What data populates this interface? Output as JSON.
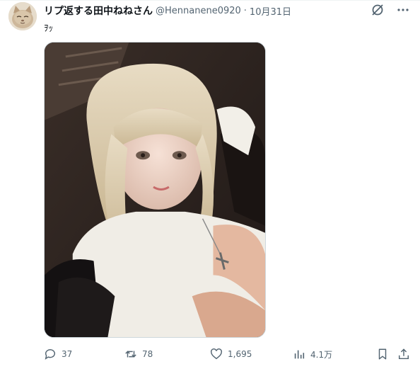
{
  "tweet": {
    "author": {
      "display_name": "リプ返する田中ねねさん",
      "handle": "@Hennanene0920",
      "avatar_icon": "cat-avatar"
    },
    "separator": "·",
    "date": "10月31日",
    "text": "ｦｯ",
    "media": {
      "kind": "photo"
    },
    "actions": {
      "reply_count": "37",
      "retweet_count": "78",
      "like_count": "1,695",
      "view_count": "4.1万"
    },
    "icons": {
      "grok": "grok-icon",
      "more": "more-icon",
      "reply": "reply-icon",
      "retweet": "retweet-icon",
      "like": "heart-icon",
      "views": "views-icon",
      "bookmark": "bookmark-icon",
      "share": "share-icon"
    },
    "colors": {
      "text": "#0f1419",
      "secondary": "#536471",
      "border": "#cfd9de"
    }
  }
}
